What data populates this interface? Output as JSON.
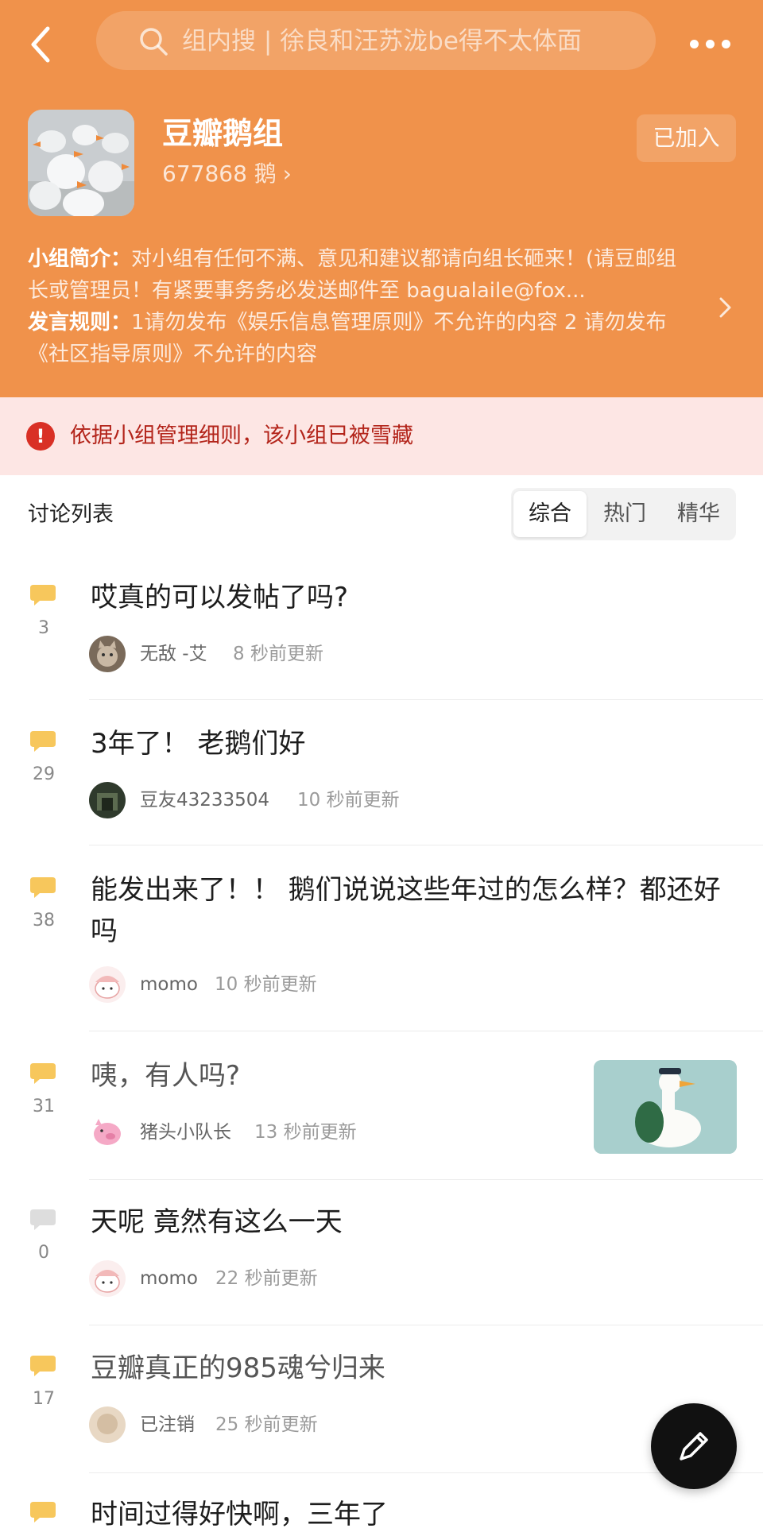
{
  "header": {
    "search_placeholder": "组内搜 | 徐良和汪苏泷be得不太体面",
    "joined_label": "已加入"
  },
  "group": {
    "name": "豆瓣鹅组",
    "member_count": "677868 鹅"
  },
  "intro": {
    "label": "小组简介：",
    "text": "对小组有任何不满、意见和建议都请向组长砸来！(请豆邮组长或管理员！有紧要事务务必发送邮件至 bagualaile@fox...",
    "rules_label": "发言规则：",
    "rules_text": "1请勿发布《娱乐信息管理原则》不允许的内容 2 请勿发布《社区指导原则》不允许的内容"
  },
  "alert": {
    "icon_text": "!",
    "text": "依据小组管理细则，该小组已被雪藏"
  },
  "list": {
    "title": "讨论列表",
    "tabs": [
      "综合",
      "热门",
      "精华"
    ]
  },
  "colors": {
    "brand": "#f0924b",
    "alert_bg": "#fde6e4",
    "alert_text": "#b3241a",
    "bubble": "#f7c75c",
    "bubble_empty": "#dddddd"
  },
  "posts": [
    {
      "count": "3",
      "title": "哎真的可以发帖了吗?",
      "author": "无敌 -艾",
      "time": "8 秒前更新",
      "avatar_icon": "cat-avatar"
    },
    {
      "count": "29",
      "title": "3年了！ 老鹅们好",
      "author": "豆友43233504",
      "time": "10 秒前更新",
      "avatar_icon": "photo-avatar"
    },
    {
      "count": "38",
      "title": "能发出来了！！ 鹅们说说这些年过的怎么样？都还好吗",
      "author": "momo",
      "time": "10 秒前更新",
      "avatar_icon": "cartoon-avatar"
    },
    {
      "count": "31",
      "title": "咦，有人吗?",
      "author": "猪头小队长",
      "time": "13 秒前更新",
      "avatar_icon": "pig-avatar",
      "thumbnail_icon": "goose-toy-thumbnail"
    },
    {
      "count": "0",
      "title": "天呢 竟然有这么一天",
      "author": "momo",
      "time": "22 秒前更新",
      "avatar_icon": "cartoon-avatar"
    },
    {
      "count": "17",
      "title": "豆瓣真正的985魂兮归来",
      "author": "已注销",
      "time": "25 秒前更新",
      "avatar_icon": "deleted-avatar"
    },
    {
      "title": "时间过得好快啊，三年了"
    }
  ]
}
